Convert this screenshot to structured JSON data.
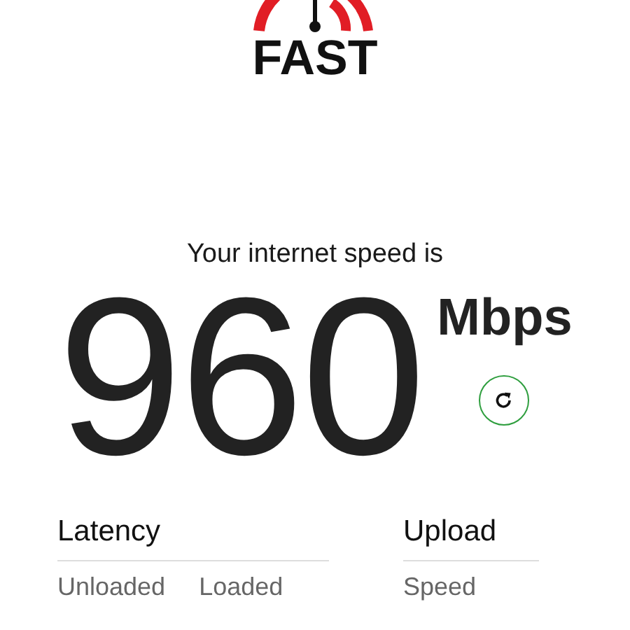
{
  "logo": {
    "text": "FAST"
  },
  "speed": {
    "caption": "Your internet speed is",
    "value": "960",
    "unit": "Mbps"
  },
  "metrics": [
    {
      "title": "Latency",
      "columns": [
        "Unloaded",
        "Loaded"
      ]
    },
    {
      "title": "Upload",
      "columns": [
        "Speed"
      ]
    }
  ]
}
